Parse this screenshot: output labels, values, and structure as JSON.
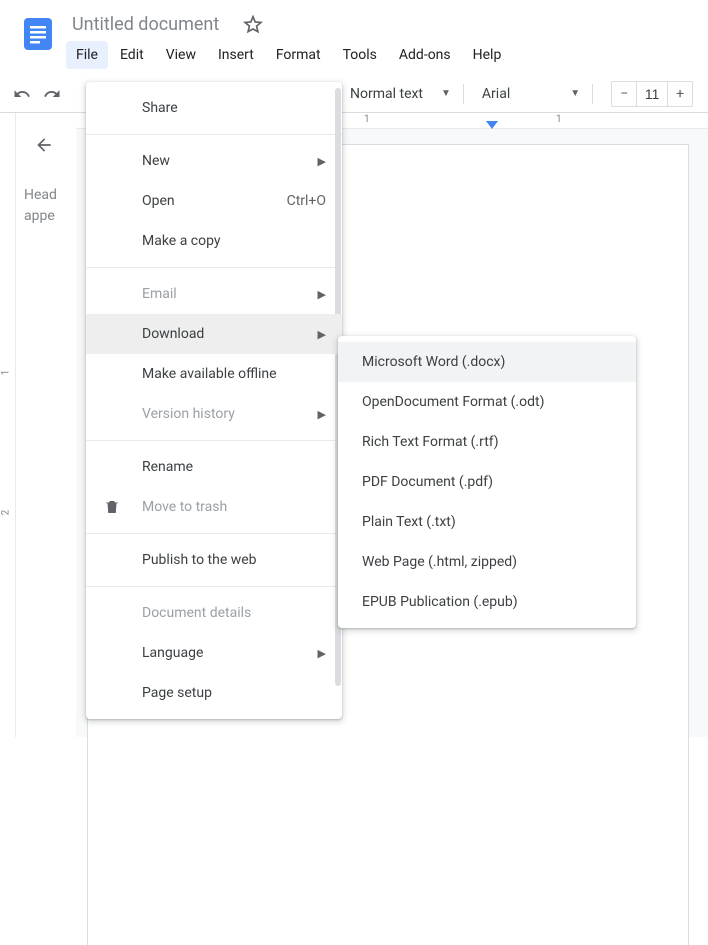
{
  "document": {
    "title": "Untitled document"
  },
  "menubar": {
    "items": [
      "File",
      "Edit",
      "View",
      "Insert",
      "Format",
      "Tools",
      "Add-ons",
      "Help"
    ]
  },
  "toolbar": {
    "style_dropdown": "Normal text",
    "font_dropdown": "Arial",
    "font_size": "11"
  },
  "ruler": {
    "h_labels": [
      "1",
      "1"
    ],
    "v_labels": [
      "1",
      "2"
    ]
  },
  "outline": {
    "placeholder_line1": "Head",
    "placeholder_line2": "appe"
  },
  "file_menu": {
    "share": "Share",
    "new": "New",
    "open": "Open",
    "open_shortcut": "Ctrl+O",
    "make_copy": "Make a copy",
    "email": "Email",
    "download": "Download",
    "make_offline": "Make available offline",
    "version_history": "Version history",
    "rename": "Rename",
    "move_to_trash": "Move to trash",
    "publish": "Publish to the web",
    "document_details": "Document details",
    "language": "Language",
    "page_setup": "Page setup"
  },
  "download_submenu": {
    "items": [
      "Microsoft Word (.docx)",
      "OpenDocument Format (.odt)",
      "Rich Text Format (.rtf)",
      "PDF Document (.pdf)",
      "Plain Text (.txt)",
      "Web Page (.html, zipped)",
      "EPUB Publication (.epub)"
    ]
  }
}
